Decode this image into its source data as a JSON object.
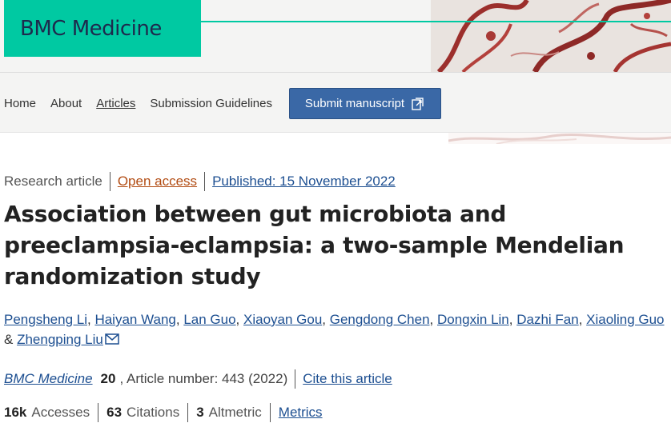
{
  "header": {
    "journal_name": "BMC Medicine"
  },
  "nav": {
    "items": [
      {
        "label": "Home"
      },
      {
        "label": "About"
      },
      {
        "label": "Articles"
      },
      {
        "label": "Submission Guidelines"
      }
    ],
    "submit_label": "Submit manuscript"
  },
  "article": {
    "type": "Research article",
    "access": "Open access",
    "published": "Published: 15 November 2022",
    "title": "Association between gut microbiota and preeclampsia-eclampsia: a two-sample Mendelian randomization study",
    "authors": [
      "Pengsheng Li",
      "Haiyan Wang",
      "Lan Guo",
      "Xiaoyan Gou",
      "Gengdong Chen",
      "Dongxin Lin",
      "Dazhi Fan",
      "Xiaoling Guo",
      "Zhengping Liu"
    ],
    "author_conjunction": "&",
    "citation": {
      "journal": "BMC Medicine",
      "volume": "20",
      "article_number": ", Article number: 443 (2022)",
      "cite_link": "Cite this article"
    },
    "metrics": {
      "accesses_value": "16k",
      "accesses_label": "Accesses",
      "citations_value": "63",
      "citations_label": "Citations",
      "altmetric_value": "3",
      "altmetric_label": "Altmetric",
      "metrics_link": "Metrics"
    }
  },
  "colors": {
    "brand_teal": "#00c9a2",
    "link_blue": "#1d4f91",
    "open_access_orange": "#b24c13",
    "button_blue": "#3a68a6"
  },
  "icons": {
    "submit": "external-document-icon",
    "author_contact": "envelope-icon"
  }
}
